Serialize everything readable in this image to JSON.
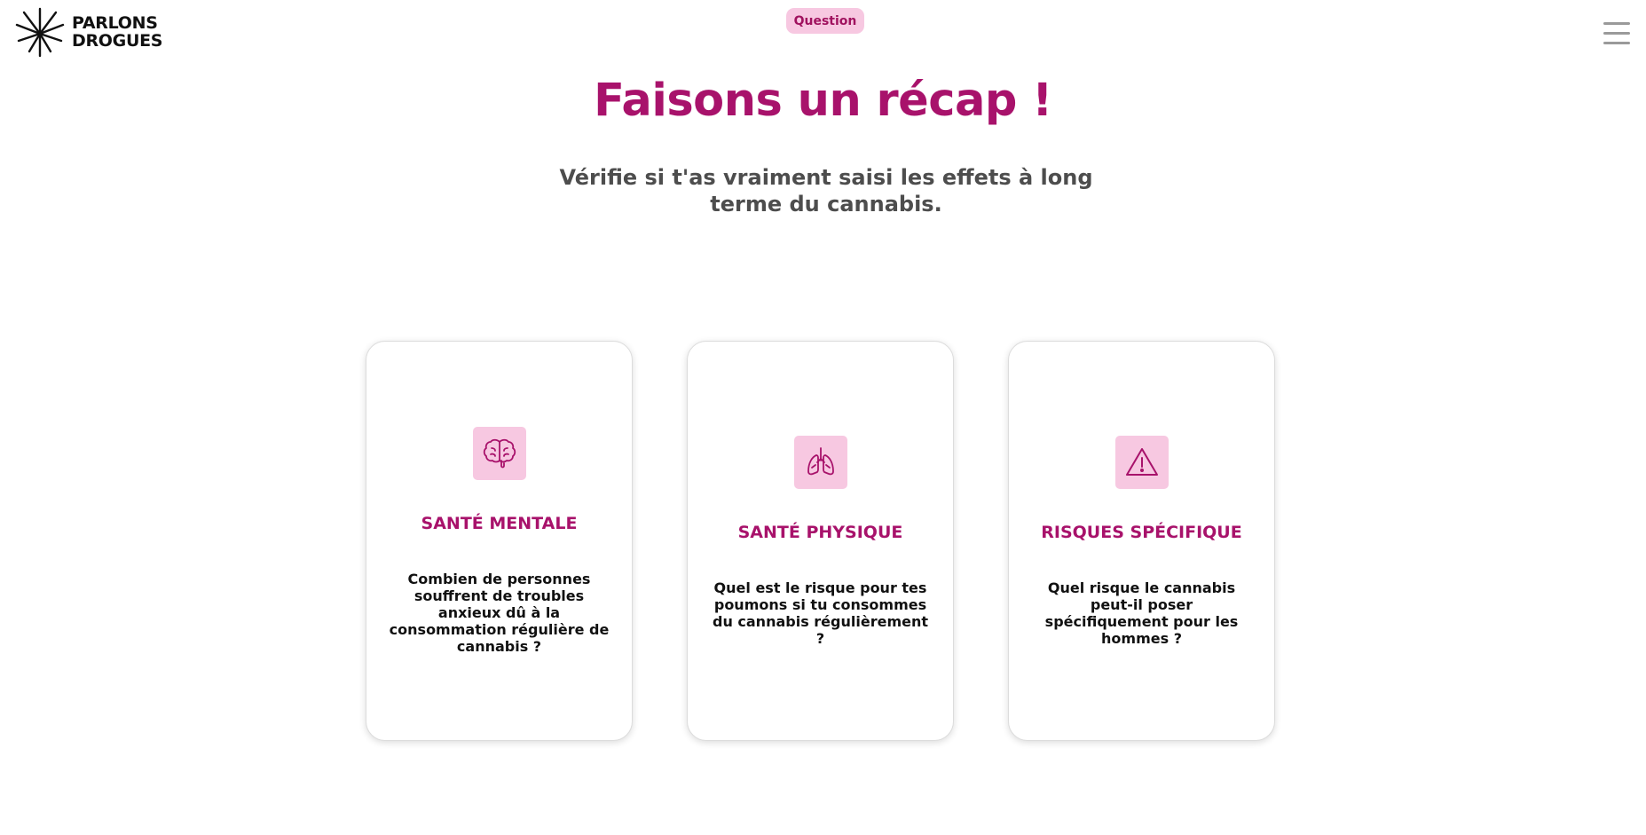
{
  "header": {
    "logo": {
      "line1": "PARLONS",
      "line2": "DROGUES",
      "icon": "cannabis-leaf-icon"
    },
    "badge": "Question",
    "menu_icon": "hamburger-menu-icon"
  },
  "main": {
    "title": "Faisons un récap !",
    "subtitle": "Vérifie si t'as vraiment saisi les effets à long terme du cannabis."
  },
  "cards": [
    {
      "icon": "brain-icon",
      "title": "SANTÉ MENTALE",
      "text": "Combien de personnes souffrent de troubles anxieux dû à la consommation régulière de cannabis ?"
    },
    {
      "icon": "lungs-icon",
      "title": "SANTÉ PHYSIQUE",
      "text": "Quel est le risque pour tes poumons si tu consommes du cannabis régulièrement ?"
    },
    {
      "icon": "warning-triangle-icon",
      "title": "RISQUES SPÉCIFIQUE",
      "text": "Quel risque le cannabis peut-il poser spécifiquement pour les hommes ?"
    }
  ],
  "colors": {
    "accent": "#a8126b",
    "badge_bg": "#f7c8e1",
    "subtitle": "#4d4d4d"
  }
}
